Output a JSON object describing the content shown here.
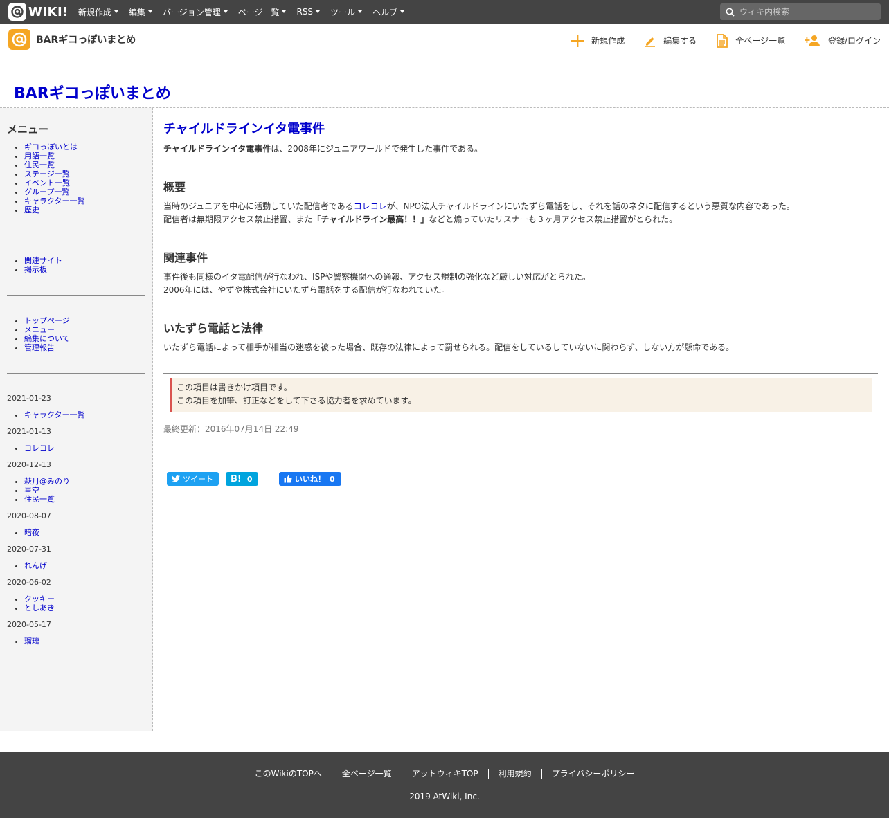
{
  "topbar": {
    "logo_text": "WIKI!",
    "nav": [
      "新規作成",
      "編集",
      "バージョン管理",
      "ページ一覧",
      "RSS",
      "ツール",
      "ヘルプ"
    ],
    "search_placeholder": "ウィキ内検索"
  },
  "header": {
    "wiki_name": "BARギコっぽいまとめ",
    "actions": [
      "新規作成",
      "編集する",
      "全ページ一覧",
      "登録/ログイン"
    ],
    "accent_color": "#f5a623"
  },
  "page_title": "BARギコっぽいまとめ",
  "sidebar": {
    "heading": "メニュー",
    "menu": [
      "ギコっぽいとは",
      "用語一覧",
      "住民一覧",
      "ステージ一覧",
      "イベント一覧",
      "グループ一覧",
      "キャラクター一覧",
      "歴史"
    ],
    "links": [
      "関連サイト",
      "掲示板"
    ],
    "admin": [
      "トップページ",
      "メニュー",
      "編集について",
      "管理報告"
    ],
    "recent": [
      {
        "date": "2021-01-23",
        "items": [
          "キャラクター一覧"
        ]
      },
      {
        "date": "2021-01-13",
        "items": [
          "コレコレ"
        ]
      },
      {
        "date": "2020-12-13",
        "items": [
          "萩月@みのり",
          "星空",
          "住民一覧"
        ]
      },
      {
        "date": "2020-08-07",
        "items": [
          "暗夜"
        ]
      },
      {
        "date": "2020-07-31",
        "items": [
          "れんげ"
        ]
      },
      {
        "date": "2020-06-02",
        "items": [
          "クッキー",
          "としあき"
        ]
      },
      {
        "date": "2020-05-17",
        "items": [
          "瑠璃"
        ]
      }
    ]
  },
  "article": {
    "title": "チャイルドラインイタ電事件",
    "intro_bold": "チャイルドラインイタ電事件",
    "intro_rest": "は、2008年にジュニアワールドで発生した事件である。",
    "sections": [
      {
        "heading": "概要"
      },
      {
        "heading": "関連事件"
      },
      {
        "heading": "いたずら電話と法律"
      }
    ],
    "s1_p1_a": "当時のジュニアを中心に活動していた配信者である",
    "s1_p1_link": "コレコレ",
    "s1_p1_b": "が、NPO法人チャイルドラインにいたずら電話をし、それを話のネタに配信するという悪質な内容であった。",
    "s1_p2_a": "配信者は無期限アクセス禁止措置、また",
    "s1_p2_bold": "「チャイルドライン最高！！」",
    "s1_p2_b": "などと煽っていたリスナーも３ヶ月アクセス禁止措置がとられた。",
    "s2_p1": "事件後も同様のイタ電配信が行なわれ、ISPや警察機関への通報、アクセス規制の強化など厳しい対応がとられた。",
    "s2_p2": "2006年には、やずや株式会社にいたずら電話をする配信が行なわれていた。",
    "s3_p1": "いたずら電話によって相手が相当の迷惑を被った場合、既存の法律によって罰せられる。配信をしているしていないに関わらず、しない方が懸命である。",
    "notice_1": "この項目は書きかけ項目です。",
    "notice_2": "この項目を加筆、訂正などをして下さる協力者を求めています。",
    "updated": "最終更新：2016年07月14日 22:49"
  },
  "share": {
    "tweet": "ツイート",
    "hatena_count": "0",
    "like": "いいね！",
    "like_count": "0"
  },
  "footer": {
    "links": [
      "このWikiのTOPへ",
      "全ページ一覧",
      "アットウィキTOP",
      "利用規約",
      "プライバシーポリシー"
    ],
    "copyright": "2019 AtWiki, Inc."
  }
}
